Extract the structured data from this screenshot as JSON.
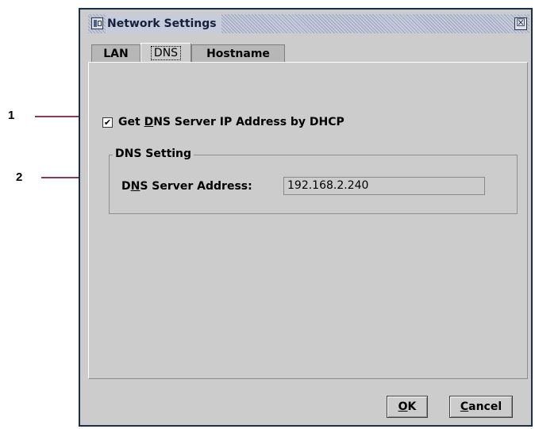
{
  "callouts": [
    {
      "number": "1"
    },
    {
      "number": "2"
    }
  ],
  "window": {
    "title": "Network Settings",
    "icons": {
      "app": "network-app-icon",
      "close": "close-icon"
    },
    "close_glyph": "☒"
  },
  "tabs": [
    {
      "label": "LAN",
      "active": false
    },
    {
      "label": "DNS",
      "active": true
    },
    {
      "label": "Hostname",
      "active": false
    }
  ],
  "dns": {
    "dhcp_checkbox": {
      "checked": true,
      "check_glyph": "✔",
      "label_pre": "Get ",
      "label_mnemonic": "D",
      "label_post": "NS Server IP Address by DHCP"
    },
    "group_title": "DNS Setting",
    "server_address": {
      "label_pre": "D",
      "label_mnemonic": "N",
      "label_post": "S Server Address:",
      "value": "192.168.2.240"
    }
  },
  "buttons": {
    "ok": {
      "mnemonic": "O",
      "rest": "K"
    },
    "cancel": {
      "mnemonic": "C",
      "rest": "ancel"
    }
  },
  "colors": {
    "window_border": "#1c2e4a",
    "panel_bg": "#cccccc",
    "callout_line": "#8c3a5c"
  }
}
